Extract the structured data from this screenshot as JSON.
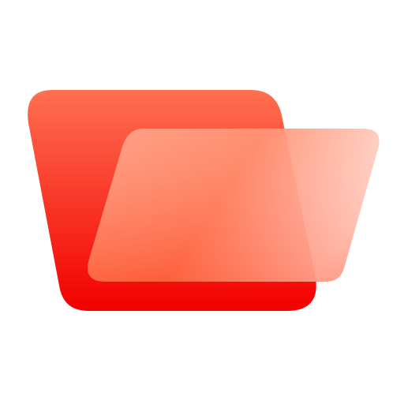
{
  "icon": {
    "name": "folder-open-icon",
    "colors": {
      "back_top": "#ff7050",
      "back_bottom": "#f20000",
      "front_left_top": "#ff9272",
      "front_left_bottom": "#ff5a2e",
      "front_right_top": "#ffd2c8",
      "front_right_bottom": "#ff7a5a",
      "background": "#ffffff"
    }
  }
}
